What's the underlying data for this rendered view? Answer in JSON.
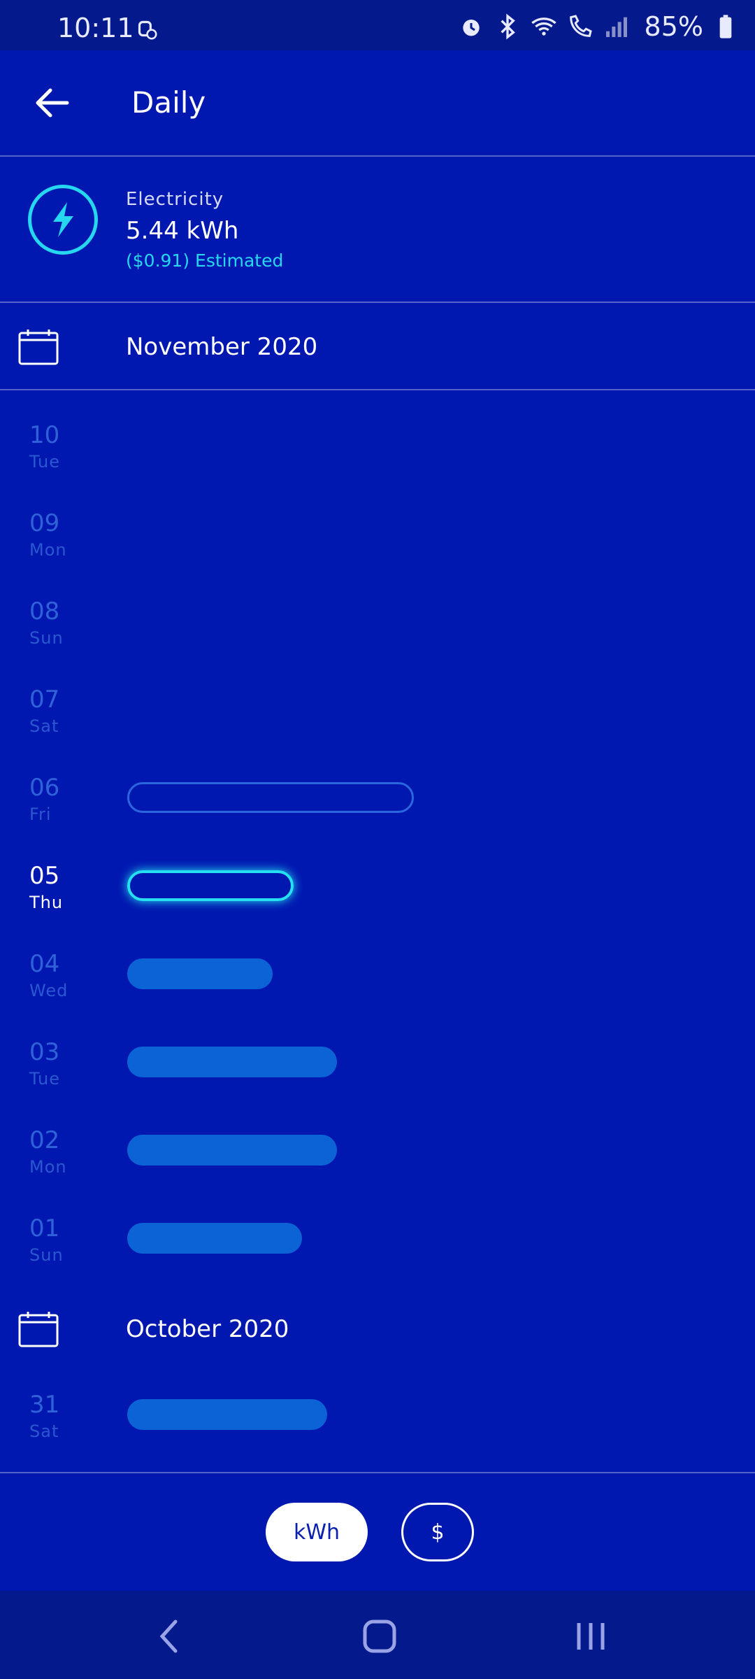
{
  "status": {
    "time": "10:11",
    "battery": "85%"
  },
  "header": {
    "title": "Daily"
  },
  "summary": {
    "label": "Electricity",
    "value": "5.44 kWh",
    "estimate": "($0.91) Estimated"
  },
  "months": [
    {
      "label": "November 2020"
    },
    {
      "label": "October 2020"
    }
  ],
  "days": [
    {
      "num": "10",
      "name": "Tue"
    },
    {
      "num": "09",
      "name": "Mon"
    },
    {
      "num": "08",
      "name": "Sun"
    },
    {
      "num": "07",
      "name": "Sat"
    },
    {
      "num": "06",
      "name": "Fri"
    },
    {
      "num": "05",
      "name": "Thu"
    },
    {
      "num": "04",
      "name": "Wed"
    },
    {
      "num": "03",
      "name": "Tue"
    },
    {
      "num": "02",
      "name": "Mon"
    },
    {
      "num": "01",
      "name": "Sun"
    },
    {
      "num": "31",
      "name": "Sat"
    }
  ],
  "toggle": {
    "kwh": "kWh",
    "usd": "$"
  },
  "colors": {
    "background": "#0018B0",
    "accent": "#25d7ef",
    "bar": "#0b63d6"
  }
}
